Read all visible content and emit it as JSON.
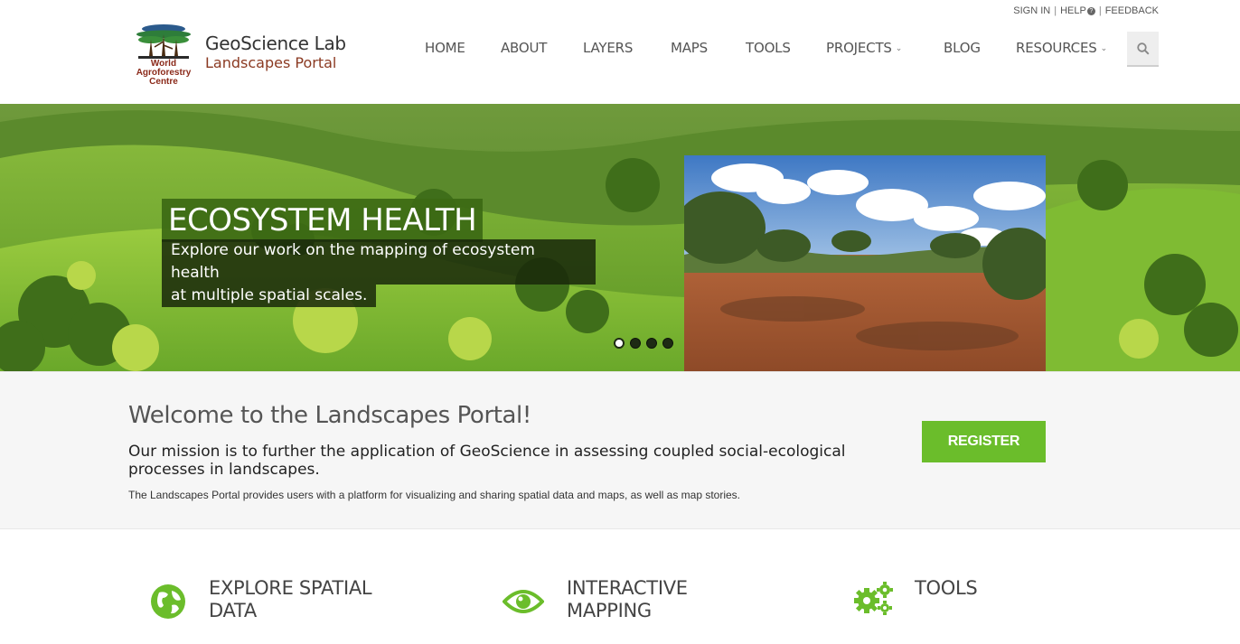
{
  "utility_nav": {
    "sign_in": "SIGN IN",
    "help": "HELP",
    "help_badge": "?",
    "feedback": "FEEDBACK"
  },
  "brand": {
    "logo_caption_line1": "World",
    "logo_caption_line2": "Agroforestry",
    "logo_caption_line3": "Centre",
    "title": "GeoScience Lab",
    "subtitle": "Landscapes Portal"
  },
  "nav": {
    "items": [
      {
        "label": "HOME"
      },
      {
        "label": "ABOUT"
      },
      {
        "label": "LAYERS"
      },
      {
        "label": "MAPS"
      },
      {
        "label": "TOOLS"
      },
      {
        "label": "PROJECTS",
        "has_dropdown": true
      },
      {
        "label": "BLOG"
      },
      {
        "label": "RESOURCES",
        "has_dropdown": true
      }
    ],
    "search_icon": "search-icon"
  },
  "hero": {
    "title": "ECOSYSTEM HEALTH",
    "line1": "Explore our work on the mapping of ecosystem health",
    "line2": "at multiple spatial scales.",
    "slide_count": 4,
    "active_slide": 1
  },
  "welcome": {
    "heading": "Welcome to the Landscapes Portal!",
    "mission": "Our mission is to further the application of GeoScience in assessing coupled social-ecological processes in landscapes.",
    "description": "The Landscapes Portal provides users with a platform for visualizing and sharing spatial data and maps, as well as map stories.",
    "register_label": "REGISTER"
  },
  "features": [
    {
      "line1": "EXPLORE SPATIAL",
      "line2": "DATA",
      "icon": "globe-icon"
    },
    {
      "line1": "INTERACTIVE",
      "line2": "MAPPING",
      "icon": "eye-icon"
    },
    {
      "line1": "TOOLS",
      "line2": "",
      "icon": "gears-icon"
    }
  ],
  "colors": {
    "accent_green": "#6bbd2b",
    "brand_red": "#8b3a22",
    "hero_title_bg": "#3c6914"
  }
}
